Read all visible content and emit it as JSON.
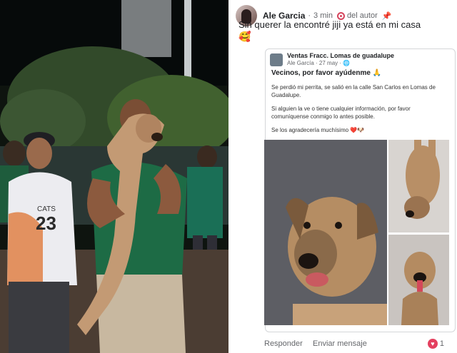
{
  "post": {
    "author": "Ale Garcia",
    "time": "3 min",
    "author_badge": "del autor",
    "text": "Sin querer la encontré jiji ya está en mi casa",
    "emoji": "🥰"
  },
  "shared": {
    "group": "Ventas Fracc. Lomas de guadalupe",
    "sub": "Ale García · 27 may · 🌐",
    "title": "Vecinos, por favor ayúdenme 🙏",
    "paragraphs": [
      "Se perdió mi perrita, se salió en la calle San Carlos en Lomas de Guadalupe.",
      "Si alguien la ve o tiene cualquier información, por favor comuníquense conmigo lo antes posible.",
      "Se los agradecería muchísimo ❤️🐶"
    ]
  },
  "photo": {
    "jersey_text": "CATS",
    "jersey_number": "23"
  },
  "footer": {
    "reply": "Responder",
    "send": "Enviar mensaje",
    "reaction_count": "1"
  },
  "icons": {
    "heart": "heart-icon",
    "pin": "pin-icon",
    "globe": "globe-icon"
  },
  "colors": {
    "accent_red": "#e4405f",
    "text": "#1c1e21",
    "muted": "#65676b"
  }
}
